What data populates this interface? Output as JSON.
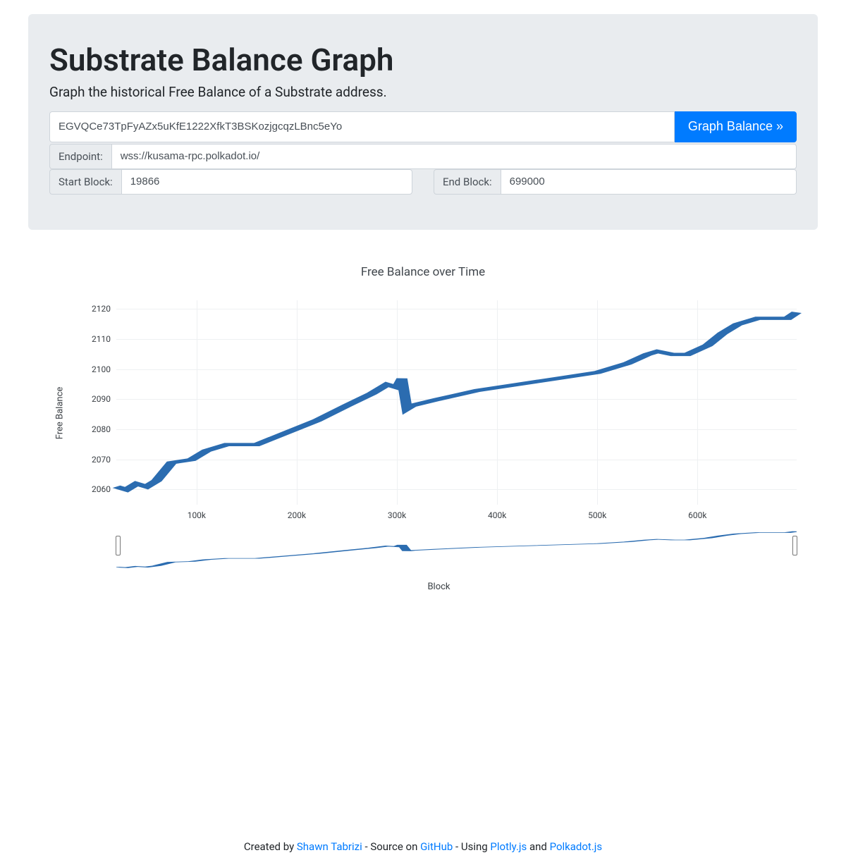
{
  "header": {
    "title": "Substrate Balance Graph",
    "subtitle": "Graph the historical Free Balance of a Substrate address."
  },
  "form": {
    "address_value": "EGVQCe73TpFyAZx5uKfE1222XfkT3BSKozjgcqzLBnc5eYo",
    "graph_button": "Graph Balance »",
    "endpoint_label": "Endpoint:",
    "endpoint_value": "wss://kusama-rpc.polkadot.io/",
    "start_block_label": "Start Block:",
    "start_block_value": "19866",
    "end_block_label": "End Block:",
    "end_block_value": "699000"
  },
  "chart_data": {
    "type": "line",
    "title": "Free Balance over Time",
    "xlabel": "Block",
    "ylabel": "Free Balance",
    "xlim": [
      19866,
      699000
    ],
    "ylim": [
      2055,
      2123
    ],
    "x_ticks": [
      100000,
      200000,
      300000,
      400000,
      500000,
      600000
    ],
    "x_tick_labels": [
      "100k",
      "200k",
      "300k",
      "400k",
      "500k",
      "600k"
    ],
    "y_ticks": [
      2060,
      2070,
      2080,
      2090,
      2100,
      2110,
      2120
    ],
    "series": [
      {
        "name": "Free Balance",
        "x": [
          19866,
          30000,
          40000,
          50000,
          60000,
          75000,
          95000,
          110000,
          130000,
          160000,
          190000,
          220000,
          250000,
          275000,
          290000,
          300000,
          305000,
          310000,
          315000,
          340000,
          380000,
          420000,
          460000,
          500000,
          530000,
          550000,
          560000,
          575000,
          590000,
          610000,
          625000,
          640000,
          660000,
          680000,
          690000,
          699000
        ],
        "values": [
          2061,
          2060,
          2062,
          2061,
          2063,
          2069,
          2070,
          2073,
          2075,
          2075,
          2079,
          2083,
          2088,
          2092,
          2095,
          2094,
          2097,
          2087,
          2088,
          2090,
          2093,
          2095,
          2097,
          2099,
          2102,
          2105,
          2106,
          2105,
          2105,
          2108,
          2112,
          2115,
          2117,
          2117,
          2117,
          2119
        ]
      }
    ]
  },
  "footer": {
    "created_by_pre": "Created by ",
    "author": "Shawn Tabrizi",
    "source_pre": " - Source on ",
    "source": "GitHub",
    "using_pre": " - Using ",
    "lib1": "Plotly.js",
    "and": " and ",
    "lib2": "Polkadot.js"
  }
}
